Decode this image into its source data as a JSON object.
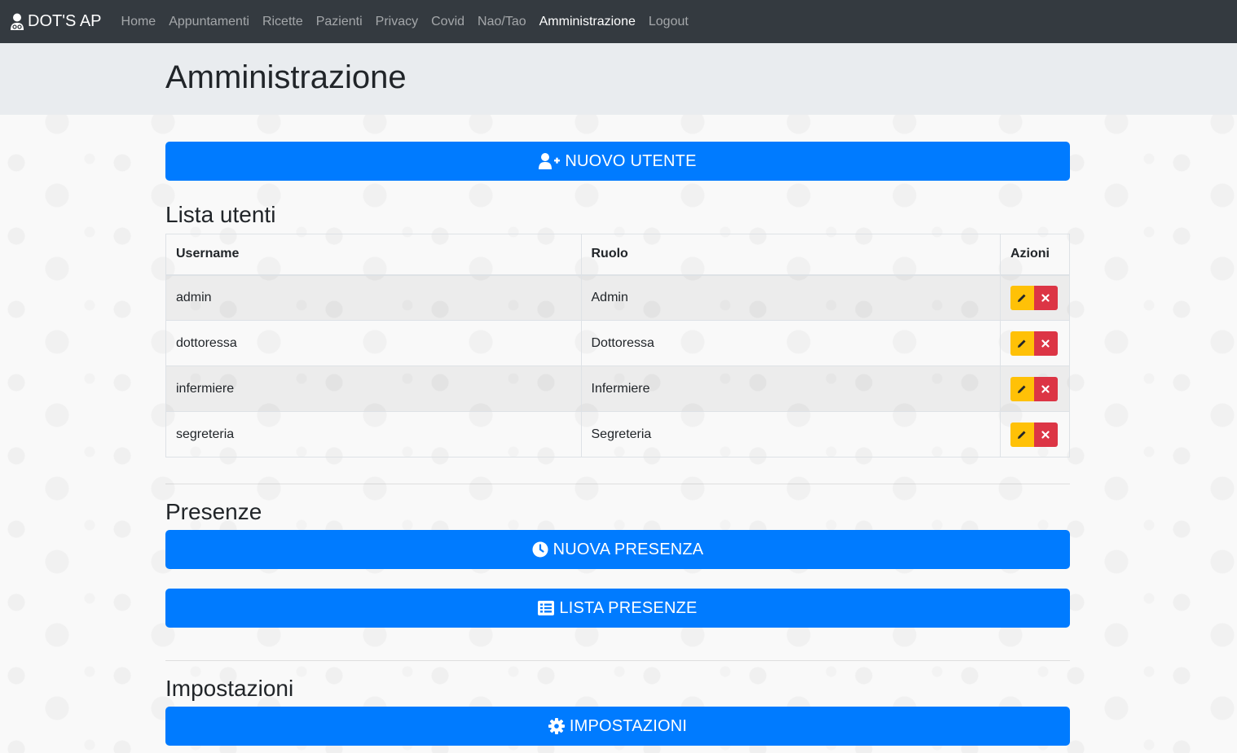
{
  "navbar": {
    "brand": "DOT'S AP",
    "links": [
      "Home",
      "Appuntamenti",
      "Ricette",
      "Pazienti",
      "Privacy",
      "Covid",
      "Nao/Tao",
      "Amministrazione",
      "Logout"
    ],
    "active": "Amministrazione"
  },
  "page": {
    "title": "Amministrazione"
  },
  "users": {
    "new_button": "NUOVO UTENTE",
    "title": "Lista utenti",
    "headers": {
      "username": "Username",
      "role": "Ruolo",
      "actions": "Azioni"
    },
    "rows": [
      {
        "username": "admin",
        "role": "Admin"
      },
      {
        "username": "dottoressa",
        "role": "Dottoressa"
      },
      {
        "username": "infermiere",
        "role": "Infermiere"
      },
      {
        "username": "segreteria",
        "role": "Segreteria"
      }
    ]
  },
  "presenze": {
    "title": "Presenze",
    "new_button": "NUOVA PRESENZA",
    "list_button": "LISTA PRESENZE"
  },
  "impostazioni": {
    "title": "Impostazioni",
    "button": "IMPOSTAZIONI"
  },
  "colors": {
    "navbar": "#343a40",
    "primary": "#007bff",
    "warning": "#ffc107",
    "danger": "#dc3545",
    "jumbotron": "#e9ecef"
  }
}
